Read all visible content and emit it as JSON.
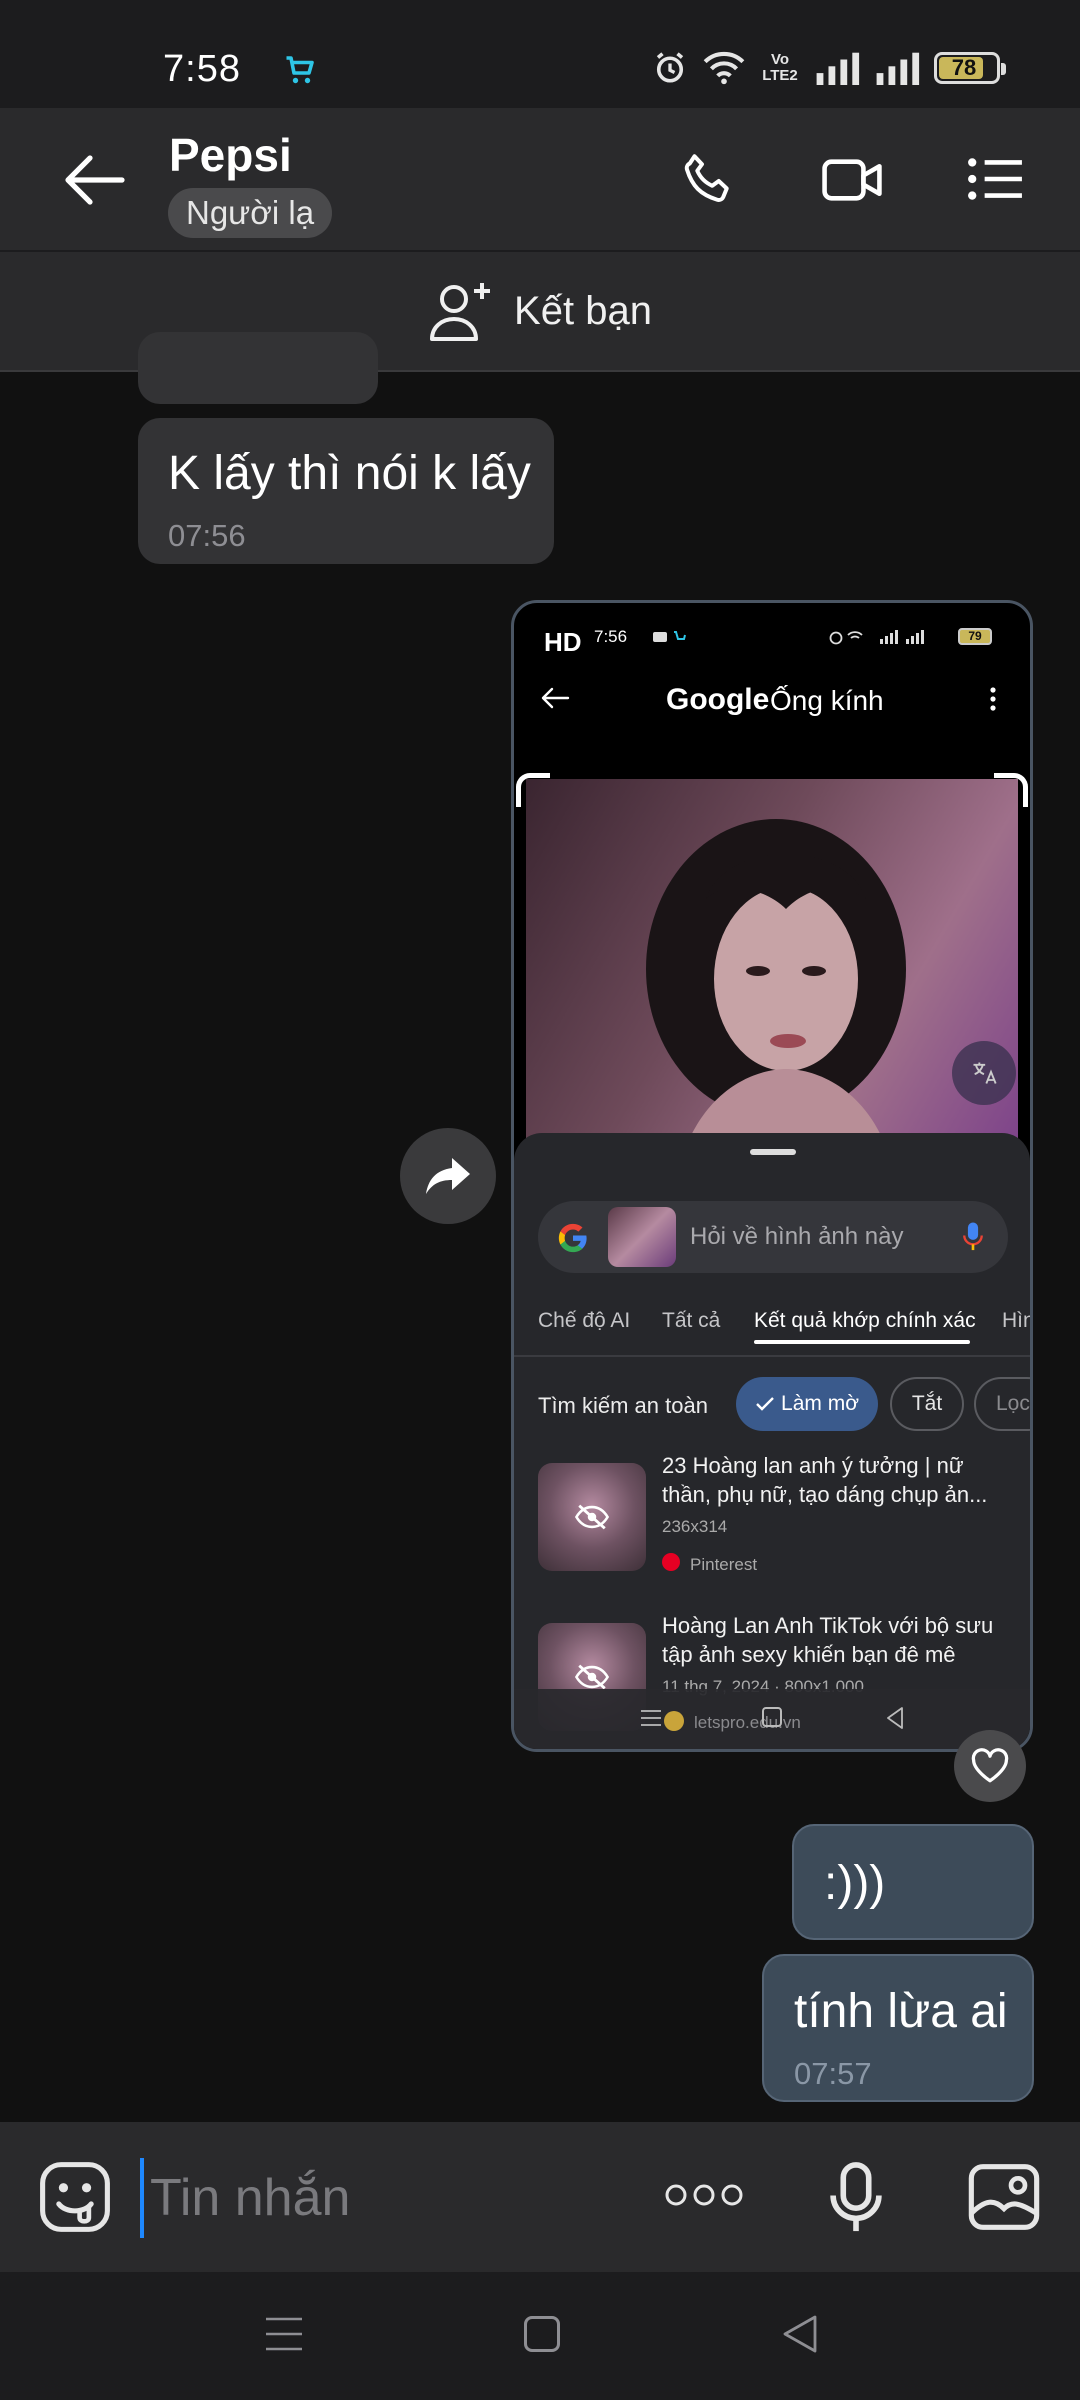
{
  "status_bar": {
    "time": "7:58",
    "network_label": "Vo LTE2",
    "battery": "78"
  },
  "header": {
    "contact_name": "Pepsi",
    "badge": "Người lạ"
  },
  "add_friend": {
    "label": "Kết bạn"
  },
  "messages": {
    "incoming_1": {
      "text": "K lấy thì nói k lấy",
      "time": "07:56"
    },
    "outgoing_1": {
      "text": ":)))"
    },
    "outgoing_2": {
      "text": "tính lừa ai",
      "time": "07:57"
    }
  },
  "screenshot": {
    "hd": "HD",
    "time": "7:56",
    "battery": "79",
    "app_brand": "Google",
    "app_title": "Ống kính",
    "search_placeholder": "Hỏi về hình ảnh này",
    "tabs": [
      "Chế độ AI",
      "Tất cả",
      "Kết quả khớp chính xác",
      "Hìn"
    ],
    "safe_search_label": "Tìm kiếm an toàn",
    "chips": [
      "Làm mờ",
      "Tắt",
      "Lọc"
    ],
    "results": [
      {
        "title": "23 Hoàng lan anh ý tưởng | nữ thần, phụ nữ, tạo dáng chụp ản...",
        "size": "236x314",
        "source": "Pinterest"
      },
      {
        "title": "Hoàng Lan Anh TikTok với bộ sưu tập ảnh sexy khiến bạn đê mê",
        "meta": "11 thg 7, 2024 · 800x1.000",
        "source": "letspro.edu.vn"
      }
    ]
  },
  "input": {
    "placeholder": "Tin nhắn"
  },
  "colors": {
    "outgoing_bubble": "#3d4b59",
    "incoming_bubble": "#333335",
    "accent_blue": "#1e88ff",
    "chip_active": "#3a5a8c"
  }
}
